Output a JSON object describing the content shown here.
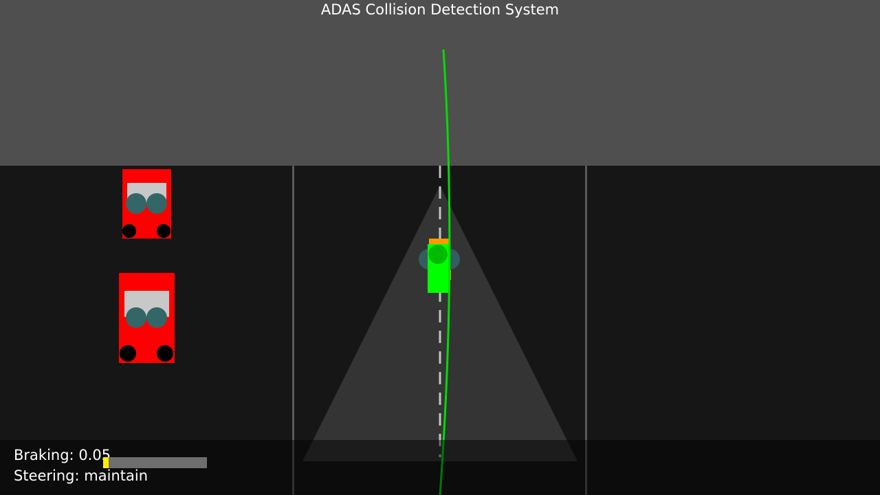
{
  "title": "ADAS Collision Detection System",
  "hud": {
    "braking_label": "Braking:",
    "braking_value": "0.05",
    "braking_level": 0.05,
    "steering_label": "Steering:",
    "steering_value": "maintain"
  },
  "colors": {
    "sky": "#4f4f4f",
    "road": "#161616",
    "lane_line": "#5a5a5a",
    "trajectory": "#00dd00",
    "ego_vehicle": "#00ff00",
    "ego_marker": "#ff9900",
    "obstacle_vehicle": "#ff0000",
    "vehicle_window": "#c8c8c8",
    "occupant": "#336666",
    "wheel": "#000000",
    "brake_fill": "#ffee00"
  }
}
